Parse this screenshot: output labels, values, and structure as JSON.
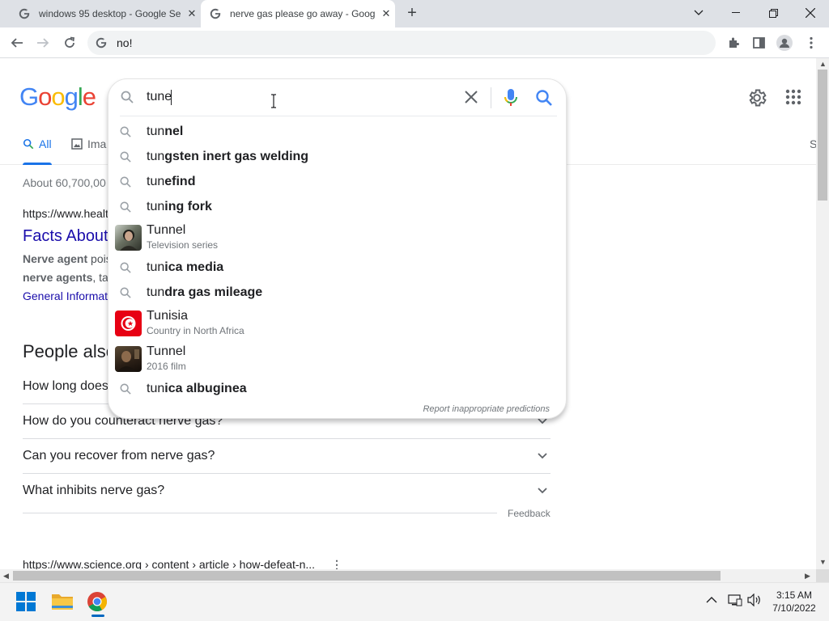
{
  "browser": {
    "tabs": [
      {
        "title": "windows 95 desktop - Google Se",
        "active": false
      },
      {
        "title": "nerve gas please go away - Goog",
        "active": true
      }
    ],
    "new_tab_label": "+",
    "address": "no!"
  },
  "page": {
    "logo": "Google",
    "tabs": {
      "all": "All",
      "images": "Ima",
      "more": "S"
    },
    "stats": "About 60,700,00",
    "result1": {
      "url": "https://www.healt",
      "title": "Facts About",
      "snippet1_bold": "Nerve agent",
      "snippet1_rest": " pois",
      "snippet2_bold": "nerve agents",
      "snippet2_rest": ", tak",
      "link": "General Informat"
    },
    "people_also_ask": "People also",
    "paa_items": [
      "How long does",
      "How do you counteract nerve gas?",
      "Can you recover from nerve gas?",
      "What inhibits nerve gas?"
    ],
    "feedback": "Feedback",
    "result2_url": "https://www.science.org › content › article › how-defeat-n..."
  },
  "search": {
    "query": "tune",
    "suggestions": [
      {
        "type": "query",
        "prefix": "tun",
        "bold": "nel"
      },
      {
        "type": "query",
        "prefix": "tun",
        "bold": "gsten inert gas welding"
      },
      {
        "type": "query",
        "prefix": "tun",
        "bold": "efind"
      },
      {
        "type": "query",
        "prefix": "tun",
        "bold": "ing fork"
      },
      {
        "type": "entity",
        "name": "Tunnel",
        "sub": "Television series"
      },
      {
        "type": "query",
        "prefix": "tun",
        "bold": "ica media"
      },
      {
        "type": "query",
        "prefix": "tun",
        "bold": "dra gas mileage"
      },
      {
        "type": "entity",
        "name": "Tunisia",
        "sub": "Country in North Africa"
      },
      {
        "type": "entity",
        "name": "Tunnel",
        "sub": "2016 film"
      },
      {
        "type": "query",
        "prefix": "tun",
        "bold": "ica albuginea"
      }
    ],
    "report": "Report inappropriate predictions"
  },
  "taskbar": {
    "time": "3:15 AM",
    "date": "7/10/2022"
  },
  "colors": {
    "link": "#1a0dab",
    "accent": "#1a73e8",
    "tab_strip": "#dee1e6",
    "omnibox": "#f1f3f4"
  },
  "icons": [
    "google-g-icon",
    "close-icon",
    "plus-icon",
    "chevron-down-icon",
    "minimize-icon",
    "restore-icon",
    "back-icon",
    "forward-icon",
    "reload-icon",
    "extensions-icon",
    "side-panel-icon",
    "profile-icon",
    "menu-icon",
    "gear-icon",
    "apps-icon",
    "search-icon",
    "mic-icon",
    "clear-icon",
    "image-icon",
    "windows-start-icon",
    "file-explorer-icon",
    "chrome-icon",
    "network-icon",
    "volume-icon",
    "tray-chevron-icon"
  ]
}
